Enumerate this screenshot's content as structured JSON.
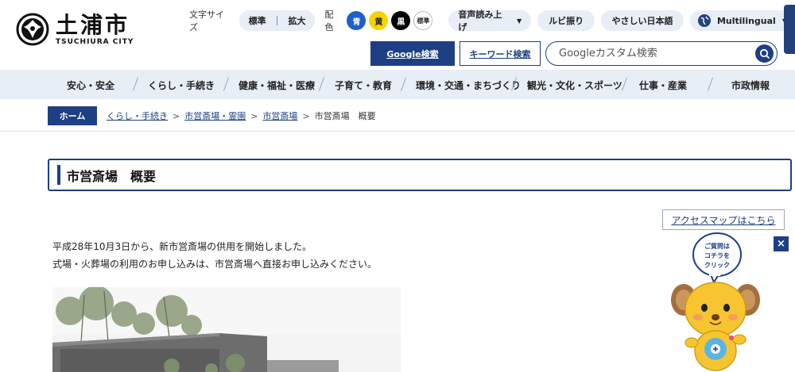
{
  "site": {
    "logo_name": "土浦市",
    "logo_sub": "TSUCHIURA CITY"
  },
  "utility": {
    "font_size_label": "文字サイズ",
    "font_standard": "標準",
    "font_large": "拡大",
    "color_label": "配色",
    "color_blue": "青",
    "color_yellow": "黄",
    "color_black": "黒",
    "color_standard": "標準",
    "read_aloud": "音声読み上げ",
    "ruby": "ルビ振り",
    "easy_japanese": "やさしい日本語",
    "multilingual": "Multilingual"
  },
  "search": {
    "google_button": "Google検索",
    "keyword_button": "キーワード検索",
    "placeholder": "Googleカスタム検索"
  },
  "gnav": {
    "items": [
      "安心・安全",
      "くらし・手続き",
      "健康・福祉・医療",
      "子育て・教育",
      "環境・交通・まちづくり",
      "観光・文化・スポーツ",
      "仕事・産業",
      "市政情報"
    ]
  },
  "breadcrumb": {
    "home": "ホーム",
    "links": [
      "くらし・手続き",
      "市営斎場・霊園",
      "市営斎場"
    ],
    "current": "市営斎場　概要",
    "separator": ">"
  },
  "page": {
    "title": "市営斎場　概要",
    "access_map_link": "アクセスマップはこちら",
    "paragraph_1": "平成28年10月3日から、新市営斎場の供用を開始しました。",
    "paragraph_2": "式場・火葬場の利用のお申し込みは、市営斎場へ直接お申し込みください。"
  },
  "mascot": {
    "bubble_line1": "ご質問は",
    "bubble_line2": "コチラを",
    "bubble_line3": "クリック",
    "close_label": "×"
  },
  "colors": {
    "brand_navy": "#1d3f84",
    "nav_bg": "#e8eef6",
    "mascot_yellow": "#f6c531"
  },
  "icons": {
    "search": "search-icon",
    "globe": "globe-icon",
    "close": "close-icon",
    "dropdown": "chevron-down-icon"
  }
}
